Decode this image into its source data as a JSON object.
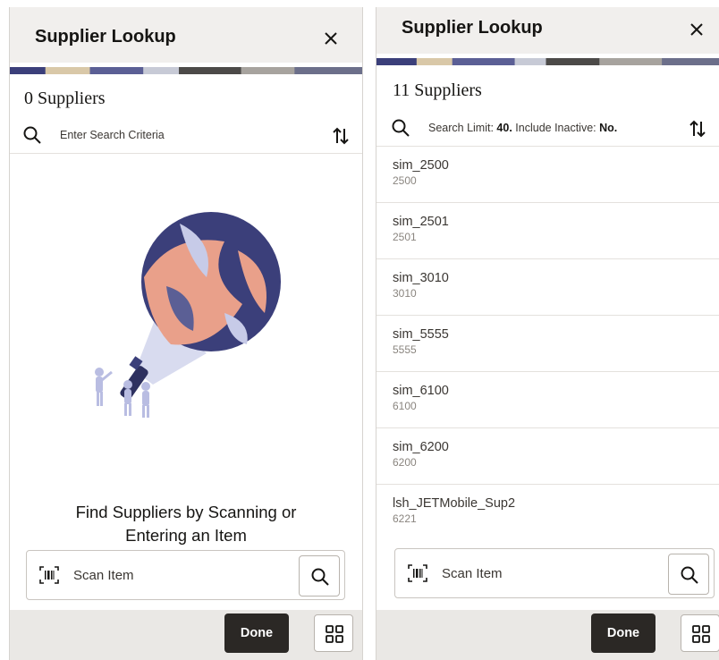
{
  "left_panel": {
    "title": "Supplier Lookup",
    "count_label": "0 Suppliers",
    "search_placeholder": "Enter Search Criteria",
    "empty_message_line1": "Find Suppliers by Scanning or",
    "empty_message_line2": "Entering an Item",
    "scan_label": "Scan Item",
    "done_label": "Done"
  },
  "right_panel": {
    "title": "Supplier Lookup",
    "count_label": "11 Suppliers",
    "search_limit_label": "Search Limit: ",
    "search_limit_value": "40.",
    "include_inactive_label": " Include Inactive: ",
    "include_inactive_value": "No.",
    "suppliers": [
      {
        "name": "sim_2500",
        "id": "2500"
      },
      {
        "name": "sim_2501",
        "id": "2501"
      },
      {
        "name": "sim_3010",
        "id": "3010"
      },
      {
        "name": "sim_5555",
        "id": "5555"
      },
      {
        "name": "sim_6100",
        "id": "6100"
      },
      {
        "name": "sim_6200",
        "id": "6200"
      },
      {
        "name": "lsh_JETMobile_Sup2",
        "id": "6221"
      }
    ],
    "scan_label": "Scan Item",
    "done_label": "Done"
  },
  "icons": {
    "close": "close-icon",
    "search": "search-icon",
    "sort": "sort-icon",
    "barcode": "barcode-scan-icon",
    "grid": "grid-icon"
  },
  "colors": {
    "header_bg": "#f1efed",
    "done_bg": "#2b2825",
    "footer_bg": "#eae8e5",
    "illustration_navy": "#3b3f7a",
    "illustration_salmon": "#e9a08a"
  }
}
